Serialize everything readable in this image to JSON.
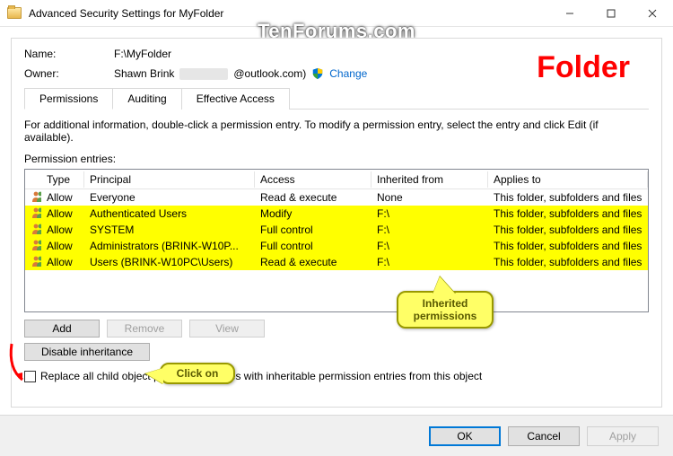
{
  "window": {
    "title": "Advanced Security Settings for MyFolder"
  },
  "watermark": "TenForums.com",
  "annotation_folder": "Folder",
  "header": {
    "name_label": "Name:",
    "name_value": "F:\\MyFolder",
    "owner_label": "Owner:",
    "owner_value": "Shawn Brink",
    "owner_email_suffix": "@outlook.com)",
    "change_label": "Change"
  },
  "tabs": {
    "permissions": "Permissions",
    "auditing": "Auditing",
    "effective": "Effective Access"
  },
  "info_text": "For additional information, double-click a permission entry. To modify a permission entry, select the entry and click Edit (if available).",
  "entries_label": "Permission entries:",
  "columns": {
    "type": "Type",
    "principal": "Principal",
    "access": "Access",
    "inherited": "Inherited from",
    "applies": "Applies to"
  },
  "rows": [
    {
      "hl": false,
      "type": "Allow",
      "principal": "Everyone",
      "access": "Read & execute",
      "inherited": "None",
      "applies": "This folder, subfolders and files"
    },
    {
      "hl": true,
      "type": "Allow",
      "principal": "Authenticated Users",
      "access": "Modify",
      "inherited": "F:\\",
      "applies": "This folder, subfolders and files"
    },
    {
      "hl": true,
      "type": "Allow",
      "principal": "SYSTEM",
      "access": "Full control",
      "inherited": "F:\\",
      "applies": "This folder, subfolders and files"
    },
    {
      "hl": true,
      "type": "Allow",
      "principal": "Administrators (BRINK-W10P...",
      "access": "Full control",
      "inherited": "F:\\",
      "applies": "This folder, subfolders and files"
    },
    {
      "hl": true,
      "type": "Allow",
      "principal": "Users (BRINK-W10PC\\Users)",
      "access": "Read & execute",
      "inherited": "F:\\",
      "applies": "This folder, subfolders and files"
    }
  ],
  "buttons": {
    "add": "Add",
    "remove": "Remove",
    "view": "View",
    "disable": "Disable inheritance",
    "ok": "OK",
    "cancel": "Cancel",
    "apply": "Apply"
  },
  "checkbox_label": "Replace all child object permission entries with inheritable permission entries from this object",
  "callouts": {
    "inherited": "Inherited permissions",
    "click_on": "Click on"
  }
}
